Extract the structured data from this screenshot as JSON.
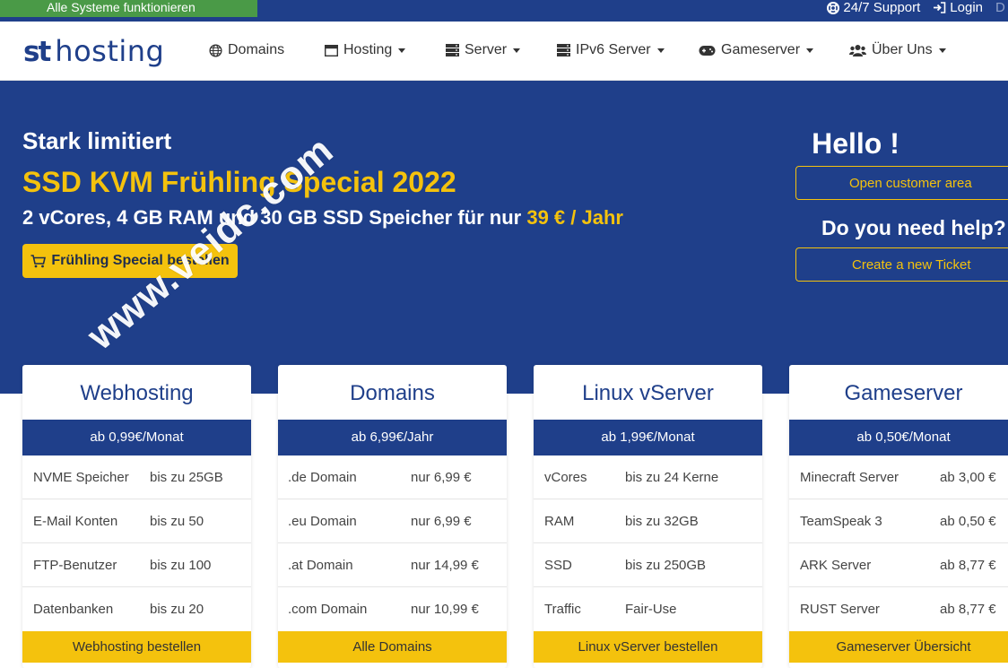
{
  "topbar": {
    "status": "Alle Systeme funktionieren",
    "support": "24/7 Support",
    "login": "Login",
    "lang_cut": "D"
  },
  "navbar": {
    "logo_st": "st",
    "logo_hosting": "hosting",
    "items": [
      {
        "label": "Domains",
        "icon": "globe-icon"
      },
      {
        "label": "Hosting",
        "icon": "window-icon"
      },
      {
        "label": "Server",
        "icon": "server-icon"
      },
      {
        "label": "IPv6 Server",
        "icon": "server-icon"
      },
      {
        "label": "Gameserver",
        "icon": "gamepad-icon"
      },
      {
        "label": "Über Uns",
        "icon": "users-icon"
      }
    ]
  },
  "hero": {
    "pre": "Stark limitiert",
    "title": "SSD KVM Frühling Special 2022",
    "sub": "2 vCores, 4 GB RAM und 30 GB SSD Speicher für nur ",
    "price": "39 € / Jahr",
    "button": "Frühling Special bestellen",
    "hello": "Hello !",
    "customer_area": "Open customer area",
    "help": "Do you need help?",
    "ticket": "Create a new Ticket"
  },
  "watermark": "www.veidc.com",
  "cards": [
    {
      "title": "Webhosting",
      "price": "ab 0,99€/Monat",
      "rows": [
        {
          "k": "NVME Speicher",
          "v": "bis zu 25GB"
        },
        {
          "k": "E-Mail Konten",
          "v": "bis zu 50"
        },
        {
          "k": "FTP-Benutzer",
          "v": "bis zu 100"
        },
        {
          "k": "Datenbanken",
          "v": "bis zu 20"
        }
      ],
      "button": "Webhosting bestellen"
    },
    {
      "title": "Domains",
      "price": "ab 6,99€/Jahr",
      "rows": [
        {
          "k": ".de Domain",
          "v": "nur 6,99 €"
        },
        {
          "k": ".eu Domain",
          "v": "nur 6,99 €"
        },
        {
          "k": ".at Domain",
          "v": "nur 14,99 €"
        },
        {
          "k": ".com Domain",
          "v": "nur 10,99 €"
        }
      ],
      "button": "Alle Domains"
    },
    {
      "title": "Linux vServer",
      "price": "ab 1,99€/Monat",
      "rows": [
        {
          "k": "vCores",
          "v": "bis zu 24 Kerne"
        },
        {
          "k": "RAM",
          "v": "bis zu 32GB"
        },
        {
          "k": "SSD",
          "v": "bis zu 250GB"
        },
        {
          "k": "Traffic",
          "v": "Fair-Use"
        }
      ],
      "button": "Linux vServer bestellen"
    },
    {
      "title": "Gameserver",
      "price": "ab 0,50€/Monat",
      "rows": [
        {
          "k": "Minecraft Server",
          "v": "ab 3,00 €"
        },
        {
          "k": "TeamSpeak 3",
          "v": "ab 0,50 €"
        },
        {
          "k": "ARK Server",
          "v": "ab 8,77 €"
        },
        {
          "k": "RUST Server",
          "v": "ab 8,77 €"
        }
      ],
      "button": "Gameserver Übersicht"
    }
  ],
  "colors": {
    "brand_blue": "#1f3f8a",
    "accent_yellow": "#f4c20d",
    "status_green": "#4a9a47"
  }
}
